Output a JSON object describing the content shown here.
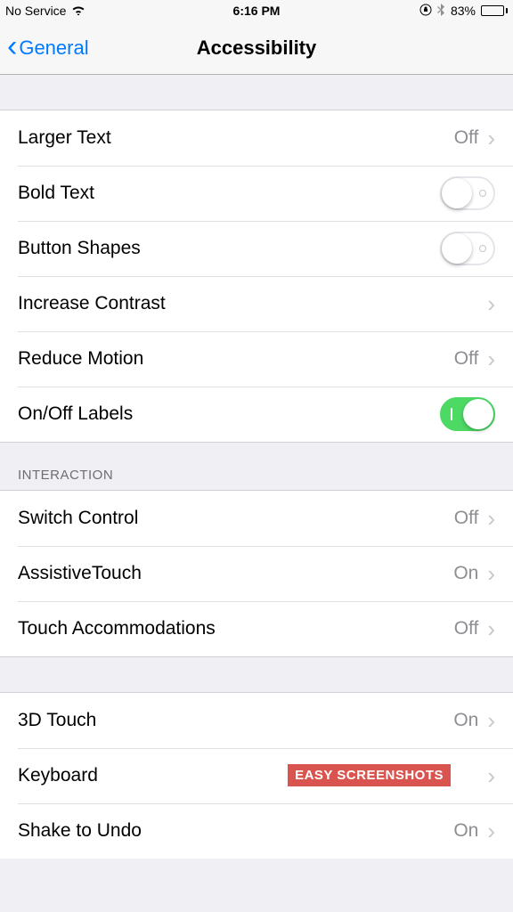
{
  "status": {
    "carrier": "No Service",
    "time": "6:16 PM",
    "battery_pct": "83%",
    "battery_fill_pct": 83
  },
  "nav": {
    "back_label": "General",
    "title": "Accessibility"
  },
  "section1": {
    "larger_text": {
      "label": "Larger Text",
      "value": "Off"
    },
    "bold_text": {
      "label": "Bold Text",
      "on": false
    },
    "button_shapes": {
      "label": "Button Shapes",
      "on": false
    },
    "increase_contrast": {
      "label": "Increase Contrast"
    },
    "reduce_motion": {
      "label": "Reduce Motion",
      "value": "Off"
    },
    "onoff_labels": {
      "label": "On/Off Labels",
      "on": true
    }
  },
  "section2": {
    "header": "INTERACTION",
    "switch_control": {
      "label": "Switch Control",
      "value": "Off"
    },
    "assistive_touch": {
      "label": "AssistiveTouch",
      "value": "On"
    },
    "touch_accommodations": {
      "label": "Touch Accommodations",
      "value": "Off"
    }
  },
  "section3": {
    "three_d_touch": {
      "label": "3D Touch",
      "value": "On"
    },
    "keyboard": {
      "label": "Keyboard"
    },
    "shake_to_undo": {
      "label": "Shake to Undo",
      "value": "On"
    }
  },
  "watermark": "EASY SCREENSHOTS"
}
